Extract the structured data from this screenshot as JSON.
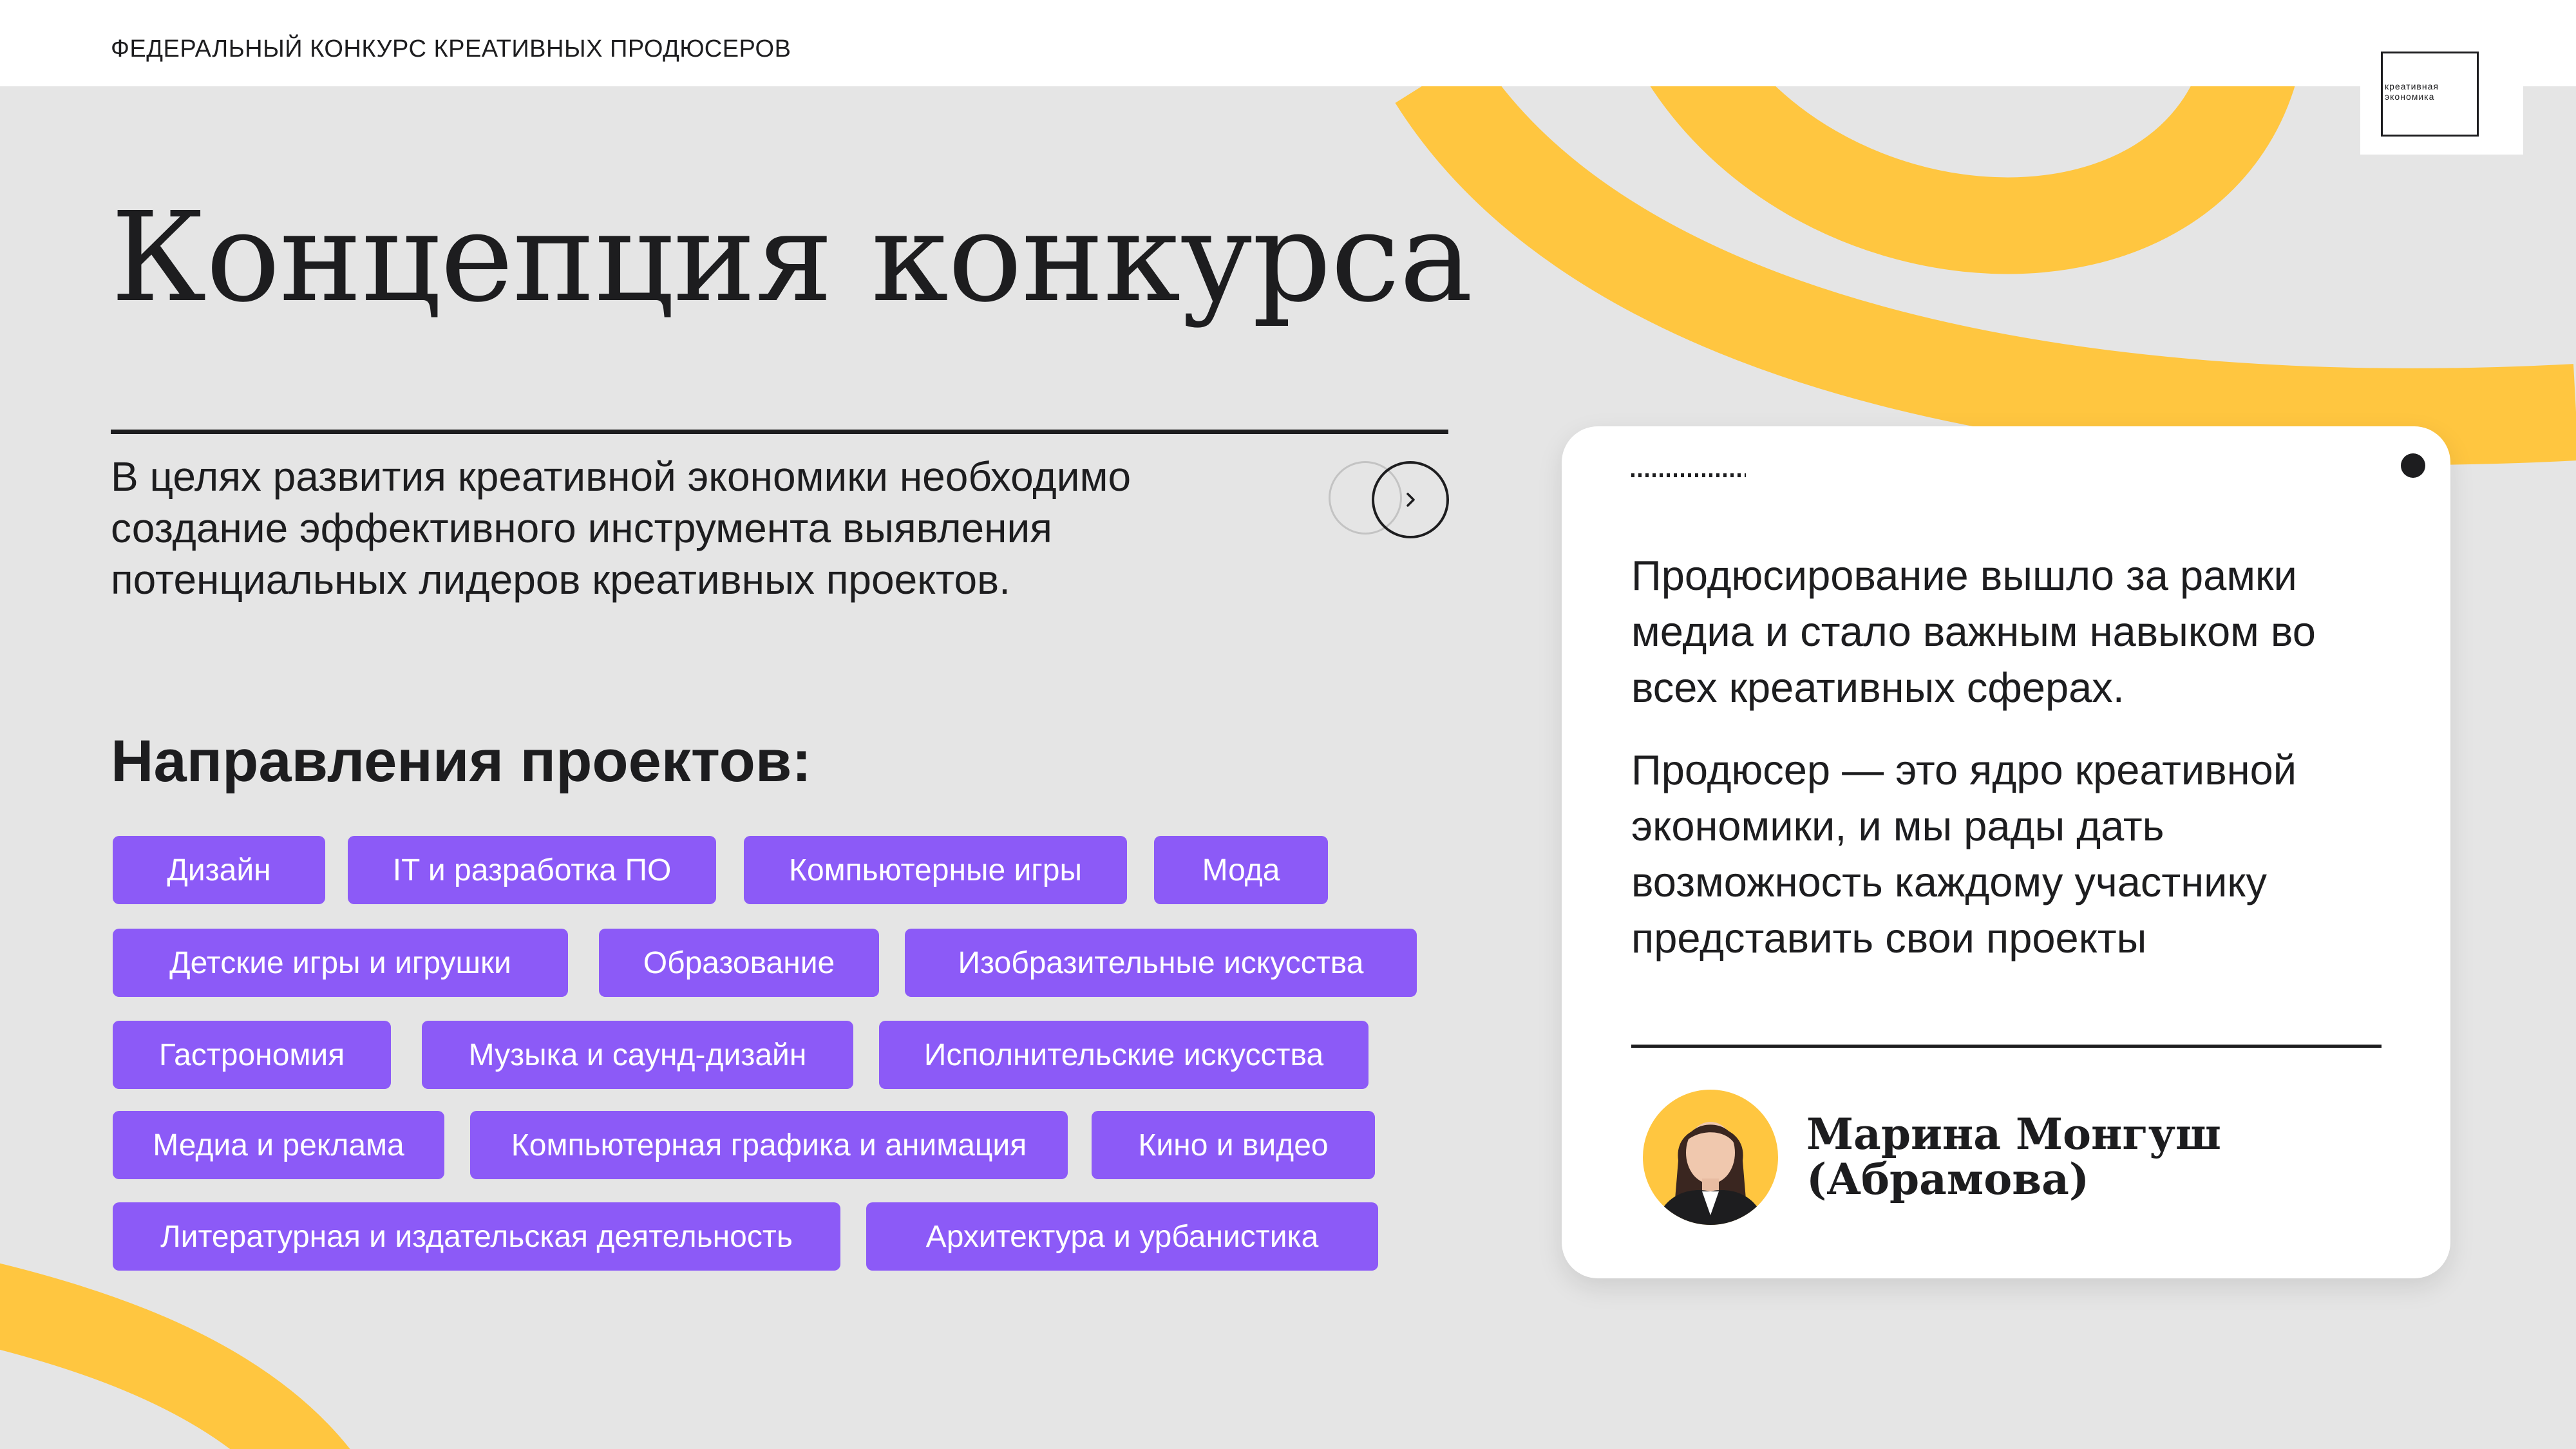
{
  "header": {
    "title": "ФЕДЕРАЛЬНЫЙ КОНКУРС КРЕАТИВНЫХ ПРОДЮСЕРОВ",
    "logo_line1": "креативная",
    "logo_line2": "экономика"
  },
  "main": {
    "title": "Концепция конкурса",
    "intro_lines": [
      "В целях развития креативной экономики необходимо",
      "создание эффективного инструмента выявления",
      "потенциальных лидеров креативных проектов."
    ],
    "next_icon": "chevron-right-icon",
    "directions_heading": "Направления проектов:",
    "tags": [
      "Дизайн",
      "IT и разработка ПО",
      "Компьютерные игры",
      "Мода",
      "Детские игры и игрушки",
      "Образование",
      "Изобразительные искусства",
      "Гастрономия",
      "Музыка и саунд-дизайн",
      "Исполнительские искусства",
      "Медиа и реклама",
      "Компьютерная графика и анимация",
      "Кино и видео",
      "Литературная и издательская деятельность",
      "Архитектура и урбанистика"
    ]
  },
  "quote_card": {
    "paragraph1_lines": [
      "Продюсирование вышло за рамки",
      "медиа и стало важным навыком во",
      "всех креативных сферах."
    ],
    "paragraph2_lines": [
      "Продюсер — это ядро креативной",
      "экономики, и мы рады дать",
      "возможность каждому участнику",
      "представить свои проекты"
    ],
    "author_lines": [
      "Марина Монгуш",
      "(Абрамова)"
    ]
  },
  "colors": {
    "background": "#e5e5e5",
    "accent_yellow": "#ffc640",
    "tag_purple": "#8c5af7",
    "text_dark": "#1d1d1f"
  }
}
